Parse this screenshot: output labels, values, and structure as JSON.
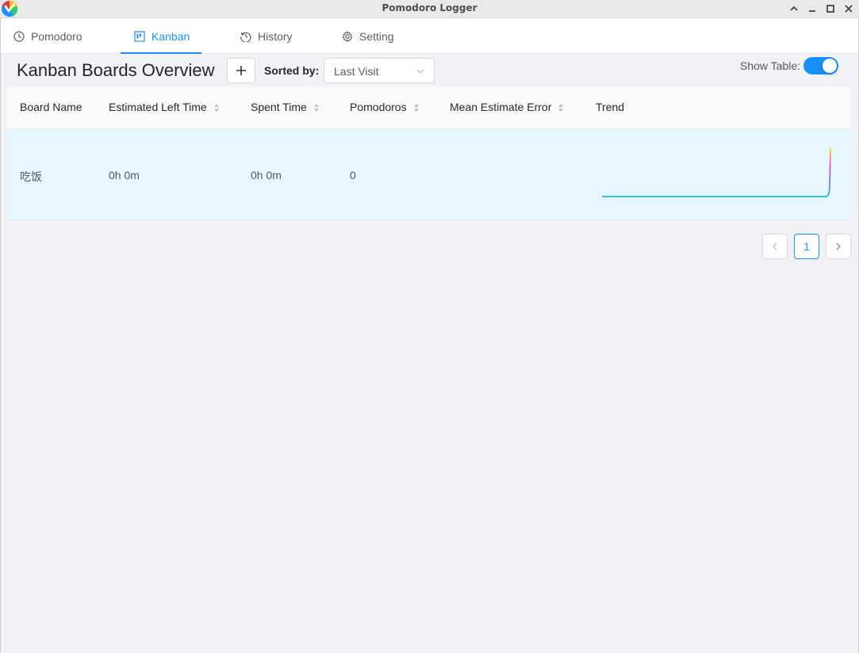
{
  "window": {
    "title": "Pomodoro Logger"
  },
  "tabs": [
    {
      "label": "Pomodoro",
      "icon": "clock-icon",
      "active": false
    },
    {
      "label": "Kanban",
      "icon": "kanban-board-icon",
      "active": true
    },
    {
      "label": "History",
      "icon": "history-icon",
      "active": false
    },
    {
      "label": "Setting",
      "icon": "gear-icon",
      "active": false
    }
  ],
  "overview": {
    "title": "Kanban Boards Overview",
    "add_button_icon": "plus-icon",
    "sorted_by_label": "Sorted by:",
    "sort_value": "Last Visit",
    "show_table_label": "Show Table:",
    "show_table_enabled": true
  },
  "table": {
    "columns": [
      {
        "label": "Board Name",
        "sortable": false
      },
      {
        "label": "Estimated Left Time",
        "sortable": true
      },
      {
        "label": "Spent Time",
        "sortable": true
      },
      {
        "label": "Pomodoros",
        "sortable": true
      },
      {
        "label": "Mean Estimate Error",
        "sortable": true
      },
      {
        "label": "Trend",
        "sortable": false
      }
    ],
    "rows": [
      {
        "board_name": "吃饭",
        "estimated_left_time": "0h 0m",
        "spent_time": "0h 0m",
        "pomodoros": "0",
        "mean_estimate_error": "",
        "trend": [
          0,
          0,
          0,
          0,
          0,
          0,
          0,
          0,
          0,
          0,
          0,
          0,
          0,
          0,
          0,
          1
        ]
      }
    ]
  },
  "pagination": {
    "current_page": "1",
    "prev_icon": "chevron-left-icon",
    "next_icon": "chevron-right-icon"
  },
  "colors": {
    "accent": "#1890ff",
    "row_highlight": "#e6f7ff",
    "trend_gradient": [
      "#00b4d8",
      "#d633ff",
      "#ffd400"
    ]
  }
}
